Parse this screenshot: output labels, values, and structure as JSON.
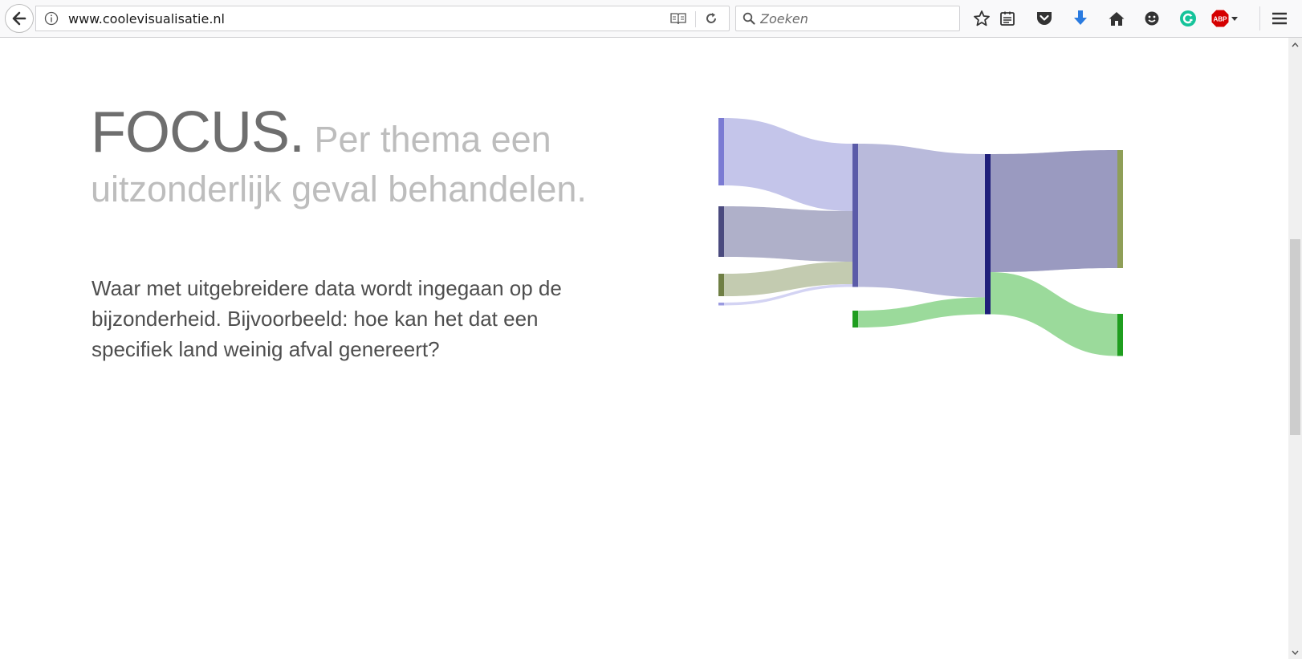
{
  "browser": {
    "url": "www.coolevisualisatie.nl",
    "search": {
      "placeholder": "Zoeken",
      "value": ""
    },
    "toolbar_icons": [
      "bookmark-star-icon",
      "reading-list-icon",
      "pocket-icon",
      "download-icon",
      "home-icon",
      "emoji-icon",
      "grammarly-icon",
      "adblock-plus-icon",
      "menu-icon"
    ],
    "adblock_badge": "ABP",
    "colors": {
      "download": "#2a7be0",
      "grammarly": "#15c39a",
      "adblock": "#d50000"
    }
  },
  "page": {
    "headline_strong": "FOCUS.",
    "headline_rest": " Per thema een uitzonderlijk geval behandelen.",
    "body": "Waar met uitgebreidere data wordt ingegaan op de bijzonderheid. Bijvoorbeeld: hoe kan het dat een specifiek land weinig afval genereert?"
  },
  "chart_data": {
    "type": "sankey",
    "title": "",
    "nodes": [
      {
        "id": "s1",
        "color": "#7b7bd3"
      },
      {
        "id": "s2",
        "color": "#4a4a7e"
      },
      {
        "id": "s3",
        "color": "#6f7f44"
      },
      {
        "id": "s4",
        "color": "#9a9ae0"
      },
      {
        "id": "m1",
        "color": "#5b5ba8"
      },
      {
        "id": "m2",
        "color": "#1f9e1f"
      },
      {
        "id": "c1",
        "color": "#1f1f7a"
      },
      {
        "id": "t1",
        "color": "#8f9f58"
      },
      {
        "id": "t2",
        "color": "#1f9e1f"
      }
    ],
    "links": [
      {
        "source": "s1",
        "target": "m1",
        "value": 48,
        "color": "#c4c5ea"
      },
      {
        "source": "s2",
        "target": "m1",
        "value": 36,
        "color": "#afb0c9"
      },
      {
        "source": "s3",
        "target": "m1",
        "value": 16,
        "color": "#c3cbb0"
      },
      {
        "source": "s4",
        "target": "m1",
        "value": 2,
        "color": "#d3d3f3"
      },
      {
        "source": "m1",
        "target": "c1",
        "value": 102,
        "color": "#b9badb"
      },
      {
        "source": "m2",
        "target": "c1",
        "value": 12,
        "color": "#9bda9b"
      },
      {
        "source": "c1",
        "target": "t1",
        "value": 84,
        "color": "#9a9ac0"
      },
      {
        "source": "c1",
        "target": "t2",
        "value": 30,
        "color": "#9bda9b"
      }
    ]
  }
}
